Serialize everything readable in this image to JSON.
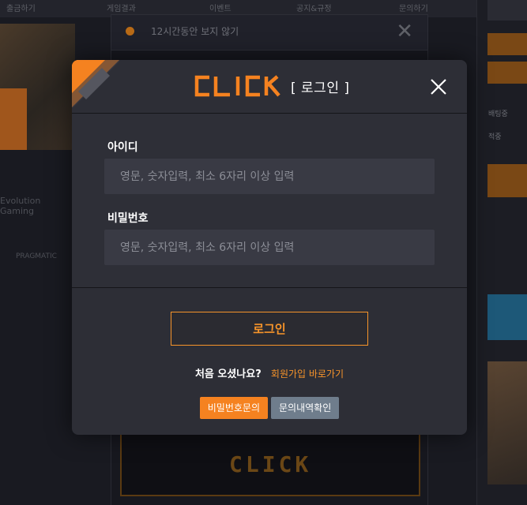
{
  "background": {
    "topbar_items": [
      "출금하기",
      "게임결과",
      "이벤트",
      "공지&규정",
      "문의하기"
    ],
    "notice_text": "12시간동안 보지 않기",
    "left_texts": [
      "Evolution Gaming",
      "PRAGMATIC"
    ],
    "right_texts": [
      "배팅중",
      "적중"
    ],
    "banner_logo": "CLICK"
  },
  "modal": {
    "logo_text": "CLICK",
    "title": "[ 로그인 ]",
    "id_label": "아이디",
    "id_placeholder": "영문, 숫자입력, 최소 6자리 이상 입력",
    "id_value": "",
    "password_label": "비밀번호",
    "password_placeholder": "영문, 숫자입력, 최소 6자리 이상 입력",
    "password_value": "",
    "login_button": "로그인",
    "first_visit_question": "처음 오셨나요?",
    "signup_link": "회원가입 바로가기",
    "password_inquiry_button": "비밀번호문의",
    "inquiry_history_button": "문의내역확인"
  },
  "colors": {
    "accent": "#f7942a",
    "modal_bg": "#2d2e36",
    "input_bg": "#393a44",
    "gray_button": "#6f7d8c"
  }
}
